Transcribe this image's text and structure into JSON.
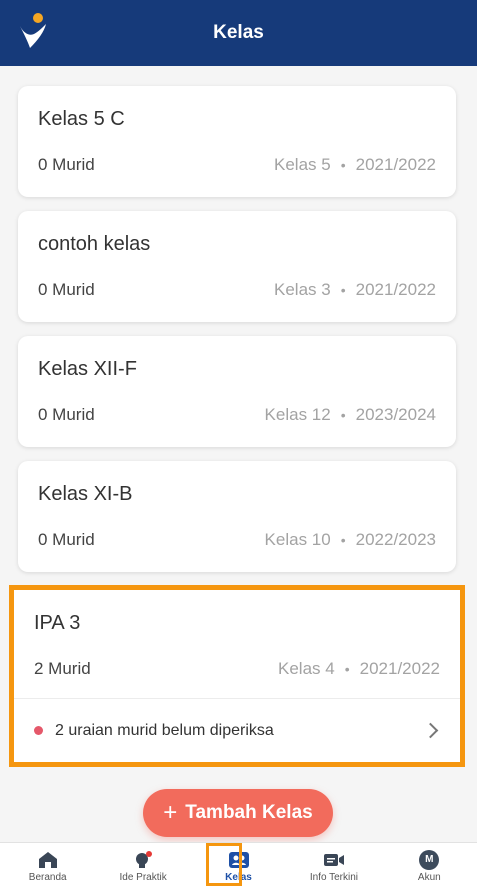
{
  "header": {
    "title": "Kelas"
  },
  "classes": [
    {
      "name": "Kelas 5 C",
      "students": "0 Murid",
      "grade": "Kelas 5",
      "year": "2021/2022"
    },
    {
      "name": "contoh kelas",
      "students": "0 Murid",
      "grade": "Kelas 3",
      "year": "2021/2022"
    },
    {
      "name": "Kelas XII-F",
      "students": "0 Murid",
      "grade": "Kelas 12",
      "year": "2023/2024"
    },
    {
      "name": "Kelas XI-B",
      "students": "0 Murid",
      "grade": "Kelas 10",
      "year": "2022/2023"
    },
    {
      "name": "IPA 3",
      "students": "2 Murid",
      "grade": "Kelas 4",
      "year": "2021/2022",
      "alert": "2 uraian murid belum diperiksa"
    }
  ],
  "add_button": {
    "label": "Tambah Kelas",
    "icon": "plus-icon"
  },
  "nav": [
    {
      "label": "Beranda",
      "icon": "home-icon"
    },
    {
      "label": "Ide Praktik",
      "icon": "lightbulb-icon"
    },
    {
      "label": "Kelas",
      "icon": "class-icon",
      "active": true
    },
    {
      "label": "Info Terkini",
      "icon": "video-icon"
    },
    {
      "label": "Akun",
      "icon": "avatar-icon",
      "avatar_letter": "M"
    }
  ],
  "colors": {
    "header": "#163a7a",
    "accent": "#f26b5c",
    "highlight": "#f5960f",
    "active_nav": "#1e50a6",
    "alert_dot": "#e5586a"
  }
}
